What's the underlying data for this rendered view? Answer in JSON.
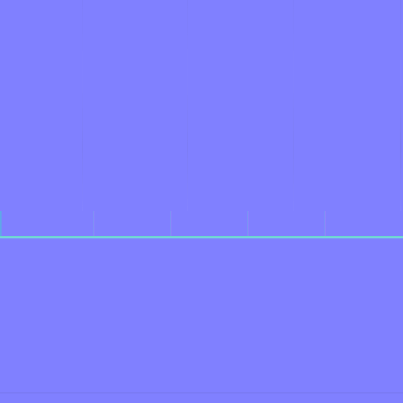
{
  "texture": {
    "background_color": "#8080ff",
    "horizontal_line_color": "#6fe0d3",
    "tick_color": "#7a95f4",
    "vertical_seam_color": "#7b7bf0"
  }
}
